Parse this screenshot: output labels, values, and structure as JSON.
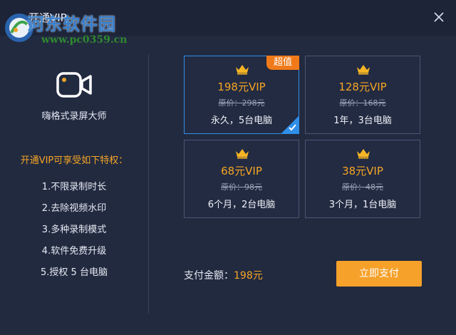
{
  "window": {
    "title": "开通VIP"
  },
  "watermark": {
    "name": "河东软件园",
    "url": "www.pc0359.cn"
  },
  "app": {
    "name": "嗨格式录屏大师"
  },
  "perks": {
    "heading": "开通VIP可享受如下特权：",
    "items": [
      "1.不限录制时长",
      "2.去除视频水印",
      "3.多种录制模式",
      "4.软件免费升级",
      "5.授权 5 台电脑"
    ]
  },
  "plans": [
    {
      "name": "198元VIP",
      "original": "原价：298元",
      "desc": "永久，5台电脑",
      "badge": "超值",
      "selected": true
    },
    {
      "name": "128元VIP",
      "original": "原价：168元",
      "desc": "1年，3台电脑",
      "selected": false
    },
    {
      "name": "68元VIP",
      "original": "原价：98元",
      "desc": "6个月，2台电脑",
      "selected": false
    },
    {
      "name": "38元VIP",
      "original": "原价：48元",
      "desc": "3个月，1台电脑",
      "selected": false
    }
  ],
  "payment": {
    "label": "支付金额：",
    "amount": "198元",
    "button": "立即支付"
  },
  "colors": {
    "accent": "#f5a524",
    "selected_border": "#2f8ee8",
    "badge": "#f07a1a",
    "background": "#222a40"
  }
}
